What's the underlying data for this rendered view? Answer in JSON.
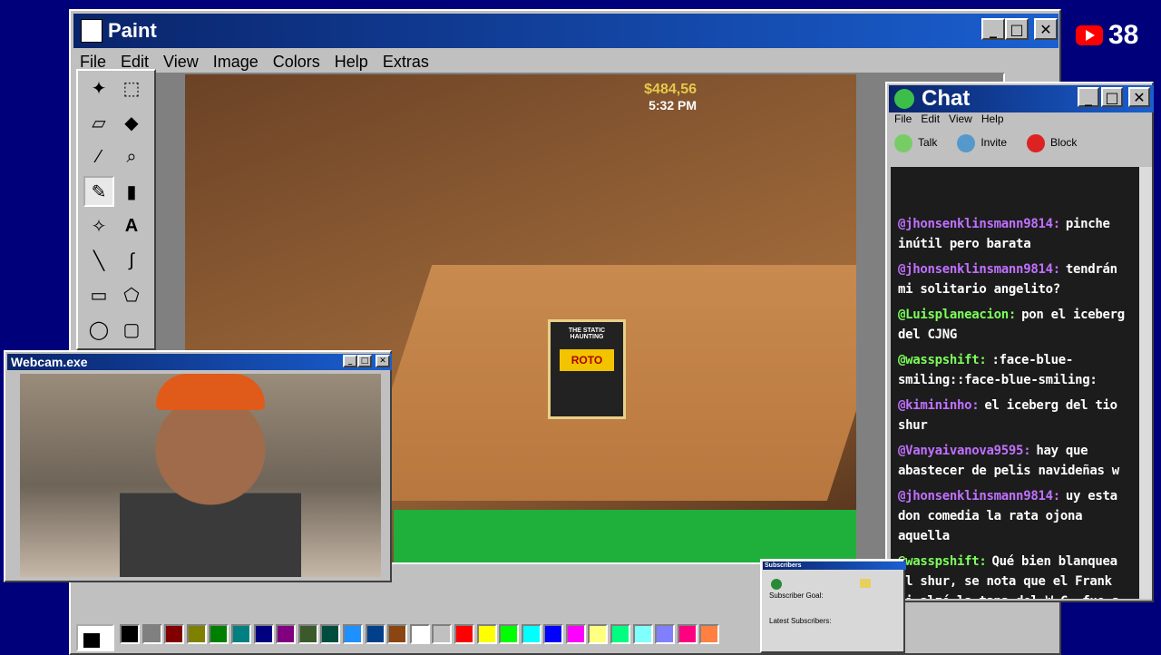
{
  "paint": {
    "title": "Paint",
    "menu": [
      "File",
      "Edit",
      "View",
      "Image",
      "Colors",
      "Help",
      "Extras"
    ],
    "palette": [
      "#000000",
      "#808080",
      "#800000",
      "#808000",
      "#008000",
      "#008080",
      "#000080",
      "#800080",
      "#3a5a2a",
      "#004d40",
      "#1e90ff",
      "#00408a",
      "#8b4513",
      "#ffffff",
      "#c0c0c0",
      "#ff0000",
      "#ffff00",
      "#00ff00",
      "#00ffff",
      "#0000ff",
      "#ff00ff",
      "#ffff80",
      "#00ff80",
      "#80ffff",
      "#8080ff",
      "#ff0080",
      "#ff8040"
    ]
  },
  "game": {
    "money": "$484,56",
    "time": "5:32 PM",
    "box_title": "THE STATIC HAUNTING",
    "box_label": "ROTO"
  },
  "webcam": {
    "title": "Webcam.exe"
  },
  "chat": {
    "title": "Chat",
    "menu": [
      "File",
      "Edit",
      "View",
      "Help"
    ],
    "toolbar": [
      "Talk",
      "Invite",
      "Block"
    ],
    "messages": [
      {
        "user": "@jhonsenklinsmann9814:",
        "text": "pinche inútil pero barata",
        "color": "#c070ff"
      },
      {
        "user": "@jhonsenklinsmann9814:",
        "text": "tendrán mi solitario angelito?",
        "color": "#c070ff"
      },
      {
        "user": "@Luisplaneacion:",
        "text": "pon el iceberg del CJNG",
        "color": "#7cff5a"
      },
      {
        "user": "@wasspshift:",
        "text": ":face-blue-smiling::face-blue-smiling:",
        "color": "#7cff5a"
      },
      {
        "user": "@kimininho:",
        "text": "el iceberg del tio shur",
        "color": "#c070ff"
      },
      {
        "user": "@Vanyaivanova9595:",
        "text": "hay que abastecer de pelis navideñas w",
        "color": "#c070ff"
      },
      {
        "user": "@jhonsenklinsmann9814:",
        "text": "uy esta don comedia la rata ojona aquella",
        "color": "#c070ff"
      },
      {
        "user": "@wasspshift:",
        "text": "Qué bien blanquea el shur, se nota que el Frank ni alzó la tapa del W.C. fue a lo que iba.",
        "color": "#7cff5a"
      }
    ]
  },
  "subscribers": {
    "title": "Subscribers",
    "goal": "Subscriber Goal:",
    "latest": "Latest Subscribers:"
  },
  "youtube": {
    "count": "38"
  }
}
